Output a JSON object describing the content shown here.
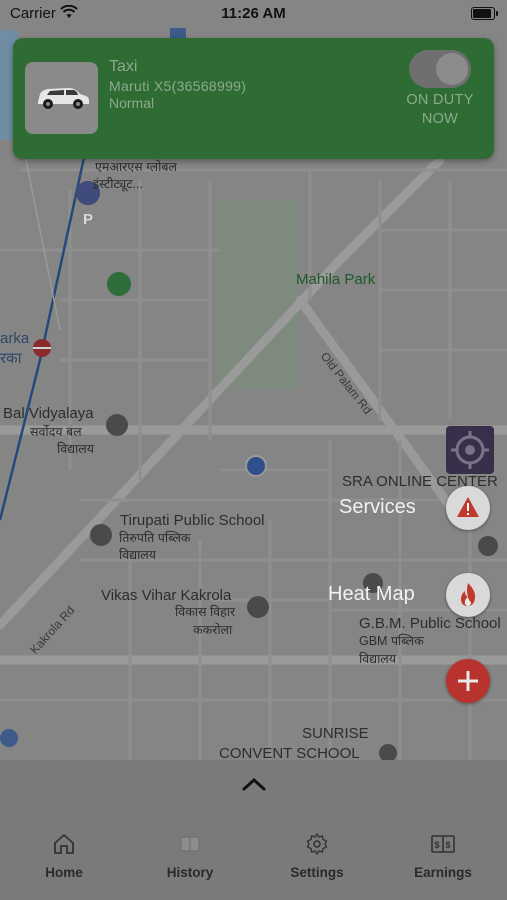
{
  "status_bar": {
    "carrier": "Carrier",
    "time": "11:26 AM",
    "battery_level": 1.0
  },
  "duty_card": {
    "vehicle_type": "Taxi",
    "vehicle_model": "Maruti X5(36568999)",
    "vehicle_class": "Normal",
    "duty_status": "ON DUTY NOW",
    "toggle_on": true
  },
  "map": {
    "labels": {
      "place_top": "एमआरएस ग्लोबल",
      "place_top2": "इंस्टीट्यूट...",
      "mahila_park": "Mahila Park",
      "old_palam_rd": "Old Palam Rd",
      "bal_vidyalaya": "Bal Vidyalaya",
      "bal_vidyalaya_hi1": "सर्वोदय बल",
      "bal_vidyalaya_hi2": "विद्यालय",
      "arka": "arka",
      "arka_hi": "रका",
      "sra": "SRA ONLINE CENTER",
      "tirupati": "Tirupati Public School",
      "tirupati_hi1": "तिरुपति पब्लिक",
      "tirupati_hi2": "विद्यालय",
      "vikas_vihar": "Vikas Vihar Kakrola",
      "vikas_vihar_hi1": "विकास विहार",
      "vikas_vihar_hi2": "ककरोला",
      "kakrola_rd": "Kakrola Rd",
      "gbm": "G.B.M. Public School",
      "gbm_hi1": "GBM पब्लिक",
      "gbm_hi2": "विद्यालय",
      "sunrise1": "SUNRISE",
      "sunrise2": "CONVENT SCHOOL"
    }
  },
  "actions": {
    "services_label": "Services",
    "heat_map_label": "Heat Map"
  },
  "tabs": [
    {
      "label": "Home",
      "icon": "home-icon"
    },
    {
      "label": "History",
      "icon": "book-icon"
    },
    {
      "label": "Settings",
      "icon": "gear-icon"
    },
    {
      "label": "Earnings",
      "icon": "money-book-icon"
    }
  ],
  "colors": {
    "duty_card_bg": "#2f6c34",
    "add_button": "#b8332e",
    "locate_button": "#3a2f4a",
    "user_dot": "#2d4f8a"
  }
}
